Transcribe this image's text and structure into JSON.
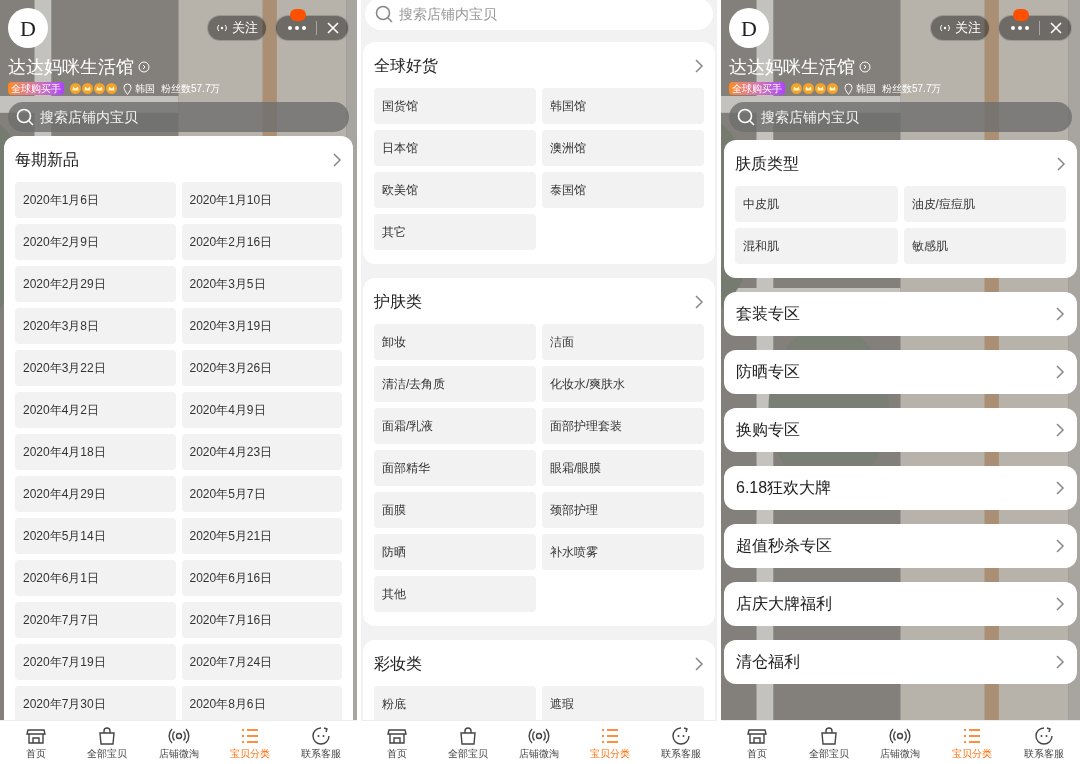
{
  "screens": [
    {
      "kind": "store_home",
      "header": {
        "logo_text": "D",
        "follow": "关注",
        "store_name": "达达妈咪生活馆",
        "badge": "全球购买手",
        "location": "韩国",
        "fans": "粉丝数57.7万"
      },
      "search": {
        "placeholder": "搜索店铺内宝贝"
      },
      "sections": [
        {
          "kind": "grid",
          "title": "每期新品",
          "items": [
            "2020年1月6日",
            "2020年1月10日",
            "2020年2月9日",
            "2020年2月16日",
            "2020年2月29日",
            "2020年3月5日",
            "2020年3月8日",
            "2020年3月19日",
            "2020年3月22日",
            "2020年3月26日",
            "2020年4月2日",
            "2020年4月9日",
            "2020年4月18日",
            "2020年4月23日",
            "2020年4月29日",
            "2020年5月7日",
            "2020年5月14日",
            "2020年5月21日",
            "2020年6月1日",
            "2020年6月16日",
            "2020年7月7日",
            "2020年7月16日",
            "2020年7月19日",
            "2020年7月24日",
            "2020年7月30日",
            "2020年8月6日"
          ]
        }
      ],
      "tabs": [
        {
          "label": "首页",
          "selected": false
        },
        {
          "label": "全部宝贝",
          "selected": false
        },
        {
          "label": "店铺微淘",
          "selected": false
        },
        {
          "label": "宝贝分类",
          "selected": true
        },
        {
          "label": "联系客服",
          "selected": false
        }
      ]
    },
    {
      "kind": "scrolled",
      "search": {
        "placeholder": "搜索店铺内宝贝"
      },
      "sections": [
        {
          "kind": "grid",
          "title": "全球好货",
          "items": [
            "国货馆",
            "韩国馆",
            "日本馆",
            "澳洲馆",
            "欧美馆",
            "泰国馆",
            "其它"
          ]
        },
        {
          "kind": "grid",
          "title": "护肤类",
          "items": [
            "卸妆",
            "洁面",
            "清洁/去角质",
            "化妆水/爽肤水",
            "面霜/乳液",
            "面部护理套装",
            "面部精华",
            "眼霜/眼膜",
            "面膜",
            "颈部护理",
            "防晒",
            "补水喷雾",
            "其他"
          ]
        },
        {
          "kind": "grid",
          "title": "彩妆类",
          "items": [
            "粉底",
            "遮瑕"
          ]
        }
      ],
      "tabs": [
        {
          "label": "首页",
          "selected": false
        },
        {
          "label": "全部宝贝",
          "selected": false
        },
        {
          "label": "店铺微淘",
          "selected": false
        },
        {
          "label": "宝贝分类",
          "selected": true
        },
        {
          "label": "联系客服",
          "selected": false
        }
      ]
    },
    {
      "kind": "store_home",
      "header": {
        "logo_text": "D",
        "follow": "关注",
        "store_name": "达达妈咪生活馆",
        "badge": "全球购买手",
        "location": "韩国",
        "fans": "粉丝数57.7万"
      },
      "search": {
        "placeholder": "搜索店铺内宝贝"
      },
      "sections": [
        {
          "kind": "grid",
          "title": "肤质类型",
          "items": [
            "中皮肌",
            "油皮/痘痘肌",
            "混和肌",
            "敏感肌"
          ]
        },
        {
          "kind": "link",
          "title": "套装专区"
        },
        {
          "kind": "link",
          "title": "防晒专区"
        },
        {
          "kind": "link",
          "title": "换购专区"
        },
        {
          "kind": "link",
          "title": "6.18狂欢大牌"
        },
        {
          "kind": "link",
          "title": "超值秒杀专区"
        },
        {
          "kind": "link",
          "title": "店庆大牌福利"
        },
        {
          "kind": "link",
          "title": "清仓福利"
        }
      ],
      "tabs": [
        {
          "label": "首页",
          "selected": false
        },
        {
          "label": "全部宝贝",
          "selected": false
        },
        {
          "label": "店铺微淘",
          "selected": false
        },
        {
          "label": "宝贝分类",
          "selected": true
        },
        {
          "label": "联系客服",
          "selected": false
        }
      ]
    }
  ]
}
